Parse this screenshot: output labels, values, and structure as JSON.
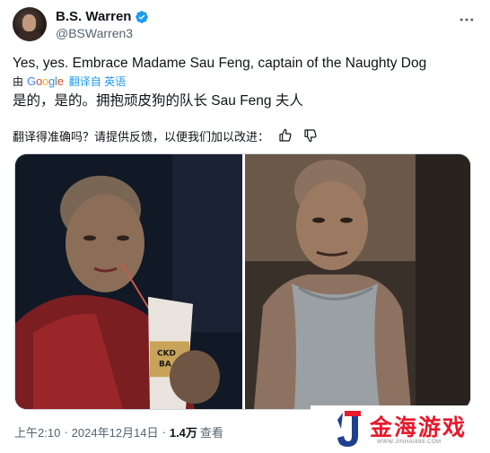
{
  "tweet": {
    "author": {
      "display_name": "B.S. Warren",
      "handle": "@BSWarren3",
      "verified": true
    },
    "more_icon": "more-horizontal-icon",
    "text": "Yes, yes. Embrace Madame Sau Feng, captain of the Naughty Dog",
    "translation": {
      "by_label": "由",
      "google_logo": "Google",
      "link_label": "翻译自 英语",
      "text": "是的，是的。拥抱顽皮狗的队长 Sau Feng 夫人"
    },
    "feedback": {
      "prompt": "翻译得准确吗？请提供反馈，以便我们加以改进：",
      "thumbs_up_icon": "thumbs-up-icon",
      "thumbs_down_icon": "thumbs-down-icon"
    },
    "media": {
      "images": [
        {
          "name": "left-photo",
          "cup_text": "CKD\nBA"
        },
        {
          "name": "right-photo"
        }
      ]
    },
    "meta": {
      "time": "上午2:10",
      "date": "2024年12月14日",
      "separator": "·",
      "views_count": "1.4万",
      "views_label": "查看"
    }
  },
  "watermark": {
    "logo_letter": "J",
    "text": "金海游戏",
    "url": "WWW.JINHAI888.COM"
  },
  "colors": {
    "link": "#1d9bf0",
    "verified": "#1d9bf0",
    "secondary_text": "#536471",
    "watermark_red": "#e8192c",
    "watermark_blue": "#1f3f8f"
  }
}
